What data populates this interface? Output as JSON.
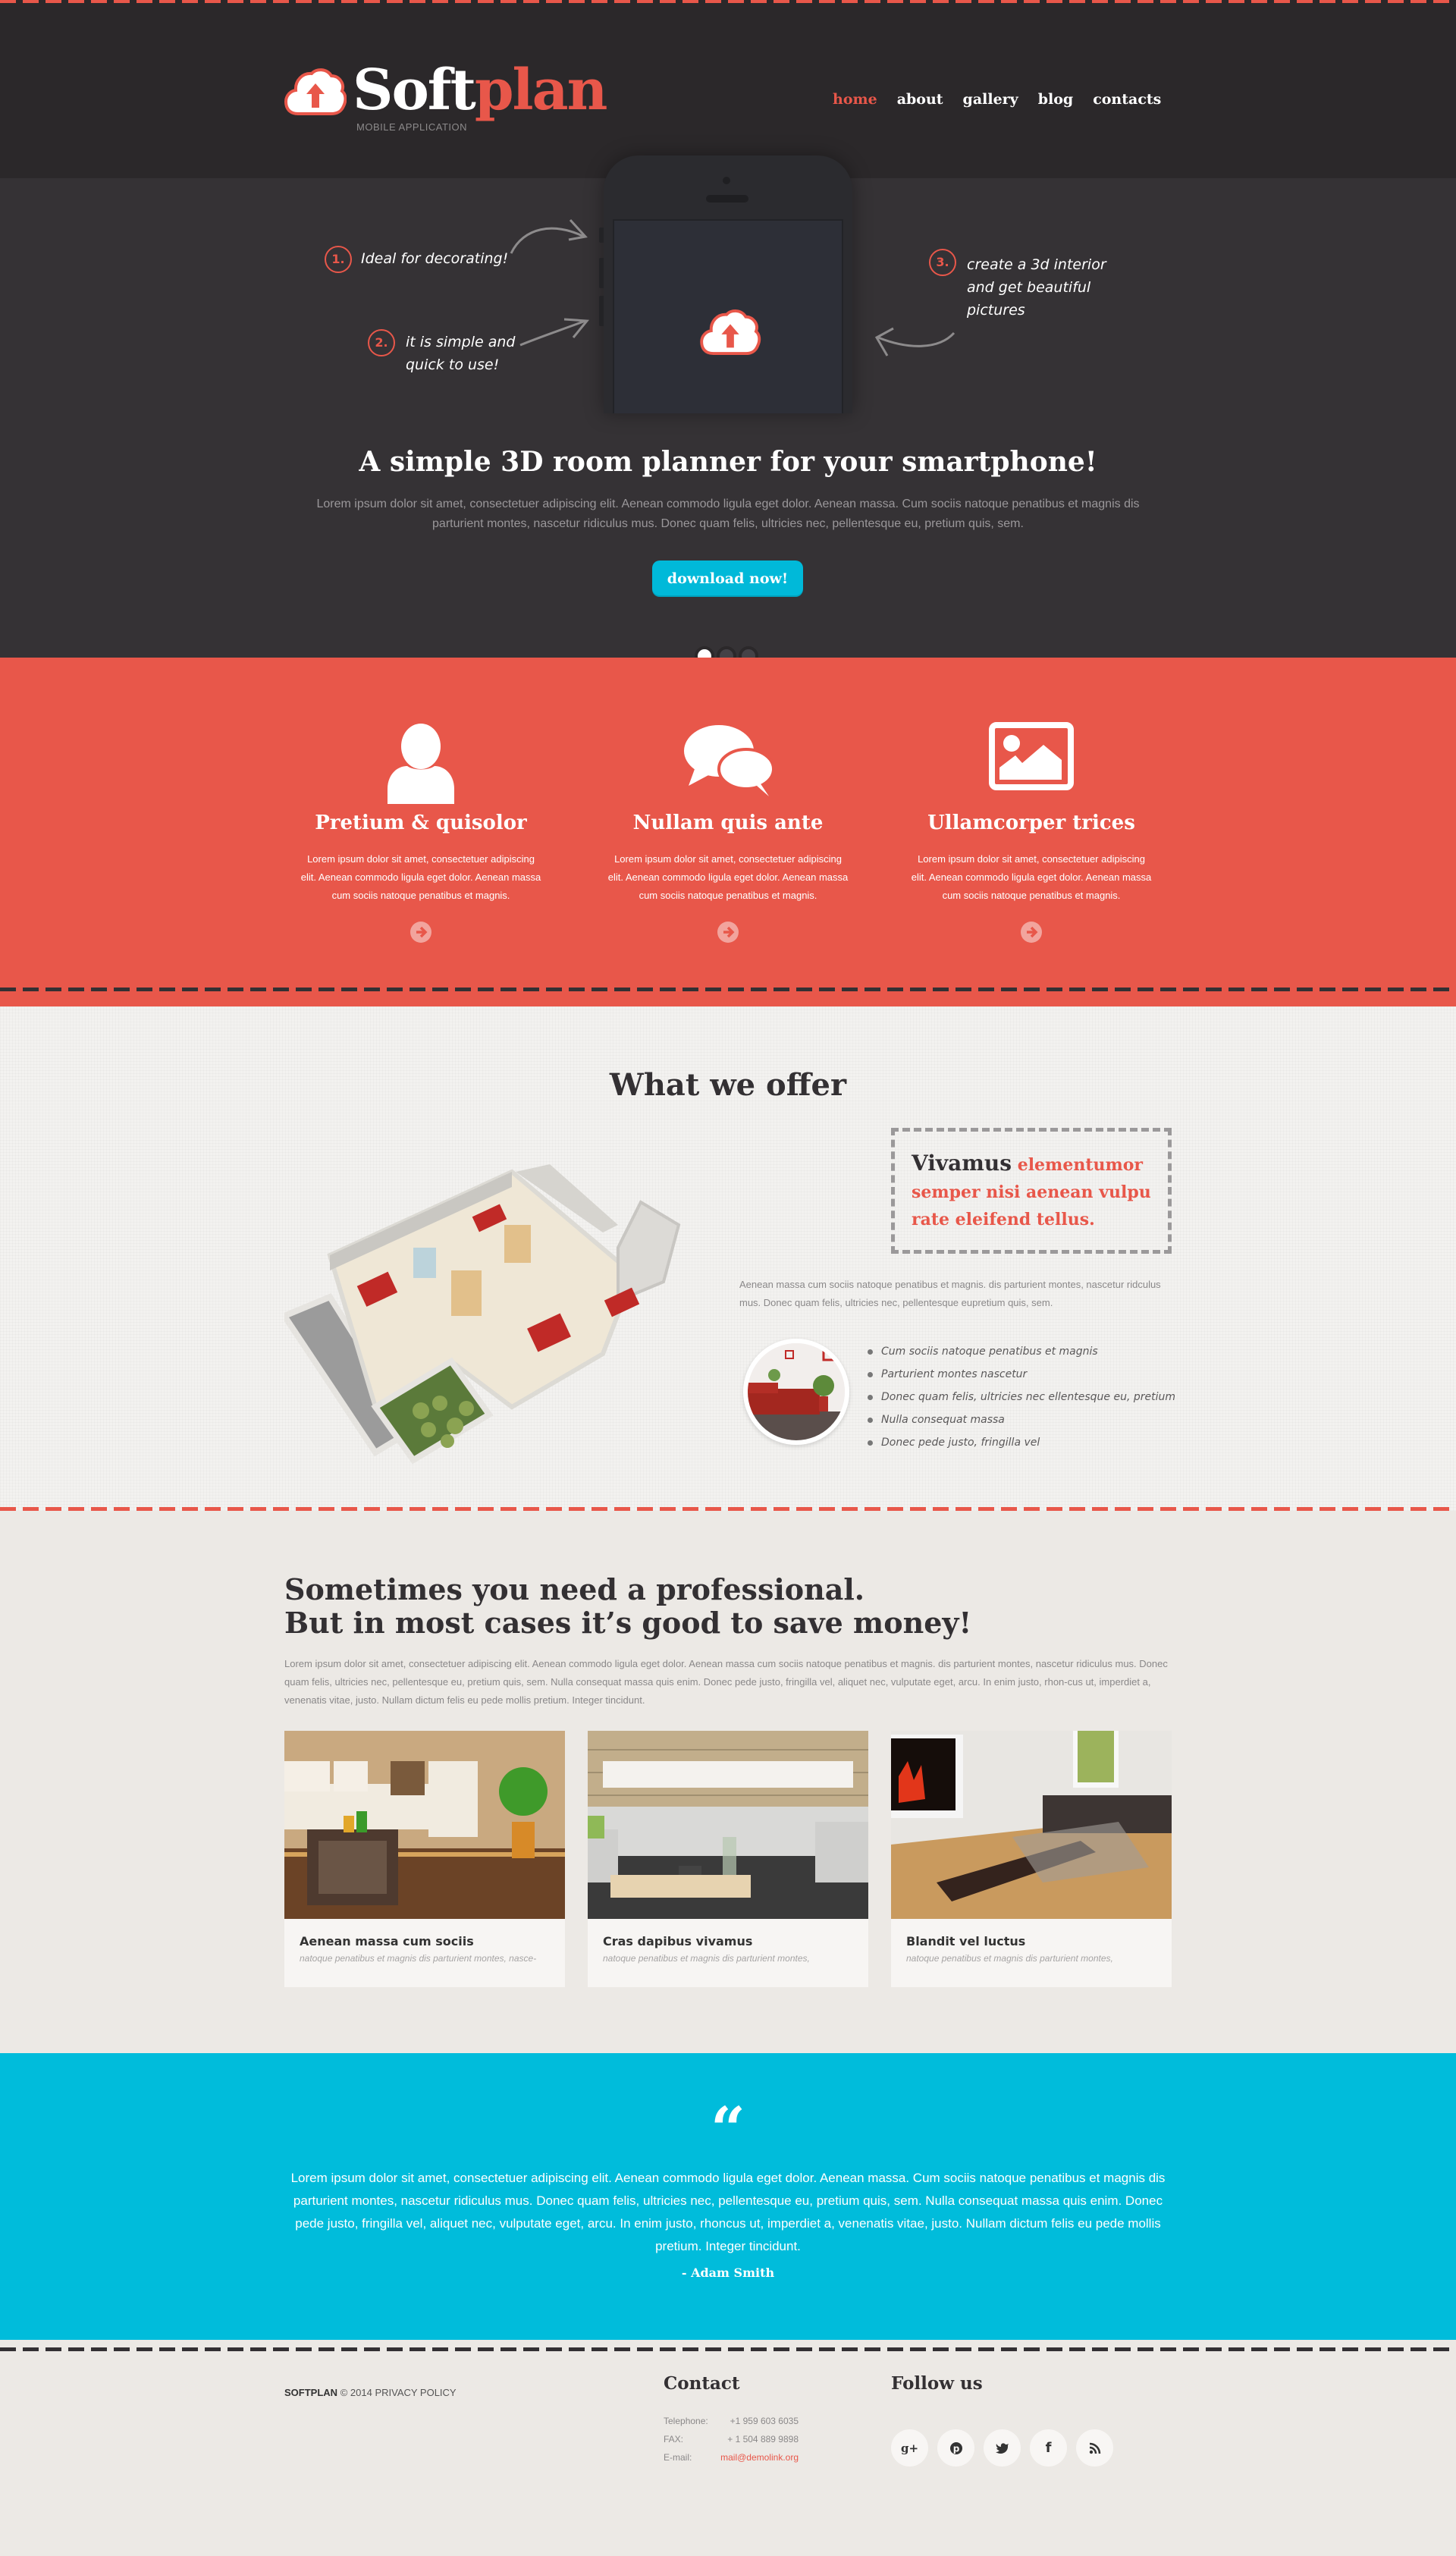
{
  "colors": {
    "accent": "#e8574a",
    "cyan": "#00bcdb",
    "dark": "#353235",
    "light": "#ece9e5"
  },
  "header": {
    "logo_soft": "Soft",
    "logo_plan": "plan",
    "logo_subtitle": "MOBILE APPLICATION",
    "nav": [
      {
        "label": "home",
        "active": true
      },
      {
        "label": "about",
        "active": false
      },
      {
        "label": "gallery",
        "active": false
      },
      {
        "label": "blog",
        "active": false
      },
      {
        "label": "contacts",
        "active": false
      }
    ]
  },
  "hero": {
    "callouts": [
      {
        "num": "1.",
        "text": "Ideal for decorating!"
      },
      {
        "num": "2.",
        "text": "it is simple and quick to use!"
      },
      {
        "num": "3.",
        "text": "create a 3d interior and get beautiful pictures"
      }
    ],
    "title": "A simple 3D room planner for your smartphone!",
    "text": "Lorem ipsum dolor sit amet, consectetuer adipiscing elit. Aenean commodo ligula eget dolor. Aenean massa. Cum sociis natoque penatibus et magnis dis parturient montes, nascetur ridiculus mus. Donec quam felis, ultricies nec, pellentesque eu, pretium quis, sem.",
    "button": "download now!",
    "slider": {
      "total": 3,
      "active_index": 0
    }
  },
  "features": [
    {
      "icon": "user-icon",
      "title": "Pretium & quisolor",
      "text": "Lorem ipsum dolor sit amet, consectetuer adipiscing elit. Aenean commodo ligula eget dolor. Aenean massa cum sociis natoque penatibus et magnis."
    },
    {
      "icon": "chat-bubbles-icon",
      "title": "Nullam quis ante",
      "text": "Lorem ipsum dolor sit amet, consectetuer adipiscing elit. Aenean commodo ligula eget dolor. Aenean massa cum sociis natoque penatibus et magnis."
    },
    {
      "icon": "image-icon",
      "title": "Ullamcorper trices",
      "text": "Lorem ipsum dolor sit amet, consectetuer adipiscing elit. Aenean commodo ligula eget dolor. Aenean massa cum sociis natoque penatibus et magnis."
    }
  ],
  "offer": {
    "title": "What we offer",
    "box_lead": "Vivamus",
    "box_rest": "elementumor semper nisi aenean vulpu rate eleifend tellus.",
    "text": "Aenean massa cum sociis natoque penatibus et magnis. dis parturient montes, nascetur ridculus mus. Donec quam felis, ultricies nec, pellentesque eupretium quis, sem.",
    "list": [
      "Cum sociis natoque penatibus et magnis",
      "Parturient montes nascetur",
      "Donec quam felis, ultricies nec ellentesque eu, pretium",
      "Nulla consequat massa",
      "Donec pede justo, fringilla vel"
    ]
  },
  "pro": {
    "title_line1": "Sometimes you need a professional.",
    "title_line2": "But in most cases it’s good to save money!",
    "text": "Lorem ipsum dolor sit amet, consectetuer adipiscing elit. Aenean commodo ligula eget dolor. Aenean massa cum sociis natoque penatibus et magnis. dis parturient montes, nascetur ridiculus mus. Donec quam felis, ultricies nec, pellentesque eu, pretium quis, sem. Nulla consequat massa quis enim. Donec pede justo, fringilla vel, aliquet nec, vulputate eget, arcu. In enim justo, rhon-cus ut, imperdiet a, venenatis vitae, justo. Nullam dictum felis eu pede mollis pretium. Integer tincidunt.",
    "cards": [
      {
        "title": "Aenean massa cum sociis",
        "subtitle": "natoque penatibus et magnis dis parturient montes, nasce-"
      },
      {
        "title": "Cras dapibus vivamus",
        "subtitle": "natoque penatibus et magnis dis parturient montes,"
      },
      {
        "title": "Blandit vel luctus",
        "subtitle": "natoque penatibus et magnis dis parturient montes,"
      }
    ]
  },
  "testimonial": {
    "mark": "“",
    "text": "Lorem ipsum dolor sit amet, consectetuer adipiscing elit. Aenean commodo ligula eget dolor. Aenean massa. Cum sociis natoque penatibus et magnis dis parturient montes, nascetur ridiculus mus. Donec quam felis, ultricies nec, pellentesque eu, pretium quis, sem. Nulla consequat massa quis enim. Donec pede justo, fringilla vel, aliquet nec, vulputate eget, arcu. In enim justo, rhoncus ut, imperdiet a, venenatis vitae, justo. Nullam dictum felis eu pede mollis pretium. Integer tincidunt.",
    "author": "-  Adam Smith"
  },
  "footer": {
    "brand": "SOFTPLAN",
    "copyright": "© 2014",
    "privacy": "PRIVACY POLICY",
    "contact_title": "Contact",
    "telephone_label": "Telephone:",
    "telephone": "+1 959 603 6035",
    "fax_label": "FAX:",
    "fax": "+ 1 504 889 9898",
    "email_label": "E-mail:",
    "email": "mail@demolink.org",
    "follow_title": "Follow us",
    "social": [
      {
        "name": "google-plus-icon",
        "glyph": "g+"
      },
      {
        "name": "pinterest-icon",
        "glyph": "P"
      },
      {
        "name": "twitter-icon",
        "glyph": "t"
      },
      {
        "name": "facebook-icon",
        "glyph": "f"
      },
      {
        "name": "rss-icon",
        "glyph": "rss"
      }
    ]
  }
}
